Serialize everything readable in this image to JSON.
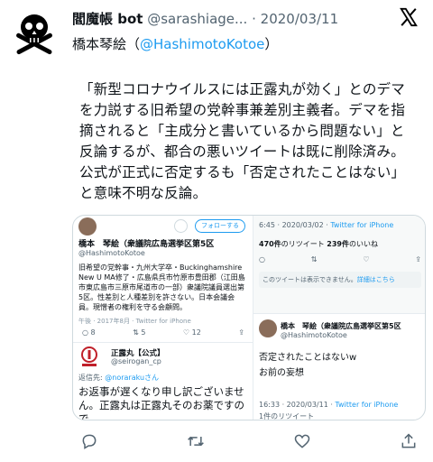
{
  "tweet": {
    "author_name": "閻魔帳 bot",
    "author_handle": "@sarashiage...",
    "separator": "·",
    "date": "2020/03/11",
    "subject_prefix": "橋本琴絵（",
    "subject_link": "@HashimotoKotoe",
    "subject_suffix": "）",
    "body": "「新型コロナウイルスには正露丸が効く」とのデマを力説する旧希望の党幹事兼差別主義者。デマを指摘されると「主成分と書いているから問題ない」と反論するが、都合の悪いツイートは既に削除済み。公式が正式に否定するも「否定されたことはない」と意味不明な反論。"
  },
  "embed": {
    "left": {
      "follow_label": "フォローする",
      "name": "橋本　琴絵（衆議院広島選挙区第5区",
      "handle": "@HashimotoKotoe",
      "bio": "旧希望の党幹事・九州大学卒・Buckinghamshire New U MA修了・広島県呉市竹原市豊田郡（江田島市東広島市三原市尾道市の一部）衆議院議員選出第5区。性差別と人種差別を許さない。日本会議会員。現憎者の権利を守る会顧問。",
      "faded_row": "午後 · 2017年8月 · Twitter for iPhone",
      "reply_count": "8",
      "retweet_count": "5",
      "like_count": "12",
      "seirogan_name": "正露丸【公式】",
      "seirogan_handle": "@seirogan_cp",
      "reply_to_label": "返信先: ",
      "reply_to_link": "@norarakuさん",
      "reply_text": "お返事が遅くなり申し訳ございません。正露丸は正露丸そのお薬ですので"
    },
    "right_top": {
      "time": "6:45 · 2020/03/02 · ",
      "client": "Twitter for iPhone",
      "rt_count": "470件",
      "rt_label": "のリツイート ",
      "like_count": "239件",
      "like_label": "のいいね",
      "notice": "このツイートは表示できません。",
      "notice_link": "詳細はこちら"
    },
    "right_bottom": {
      "name": "橋本　琴絵（衆議院広島選挙区第5区",
      "handle": "@HashimotoKotoe",
      "line1": "否定されたことはないw",
      "line2": "お前の妄想",
      "time": "16:33 · 2020/03/11 · ",
      "client": "Twitter for iPhone",
      "rt": "1件のリツイート"
    }
  },
  "colors": {
    "accent": "#1d9bf0",
    "text": "#0f1419",
    "muted": "#536471",
    "border": "#cfd9de"
  }
}
